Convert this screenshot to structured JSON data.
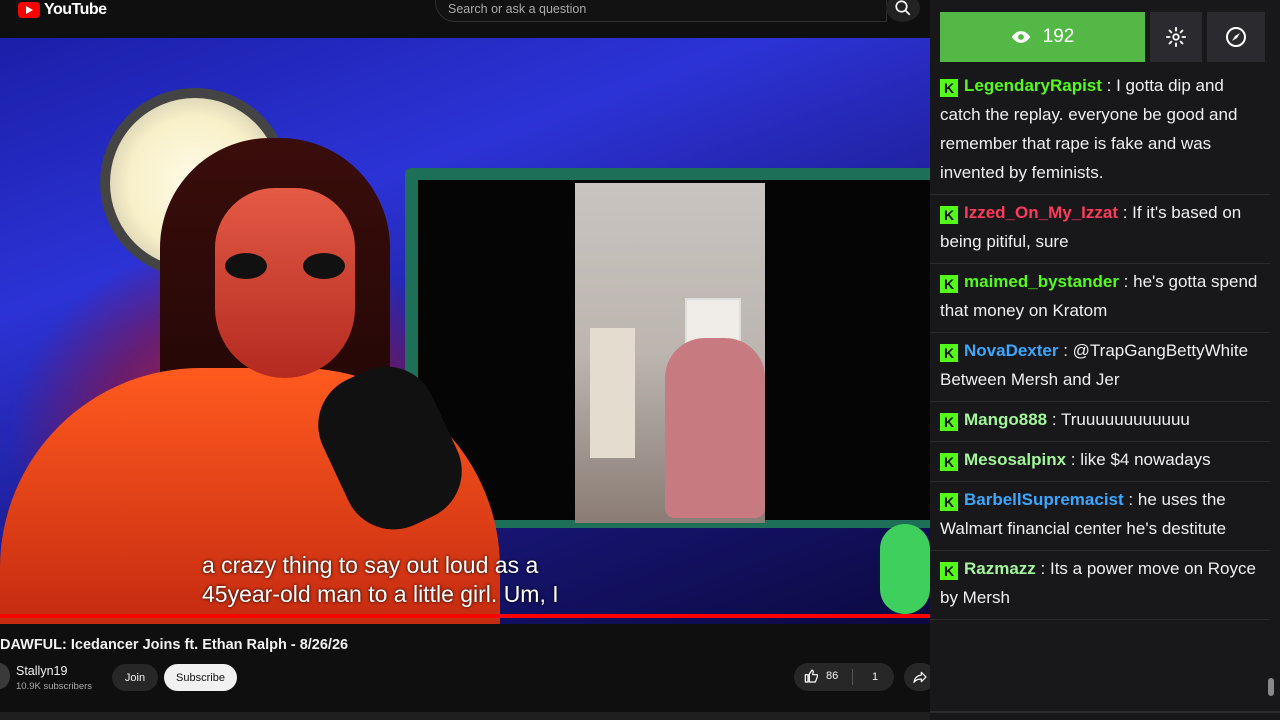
{
  "header": {
    "logo_text": "YouTube",
    "search_placeholder": "Search or ask a question"
  },
  "video": {
    "caption_line1": "a crazy thing to say out loud as a",
    "caption_line2": "45year-old man to a little girl. Um, I",
    "progress_fraction": 1.0,
    "title": "DAWFUL: Icedancer Joins ft. Ethan Ralph - 8/26/26"
  },
  "channel": {
    "name": "Stallyn19",
    "subscribers": "10.9K subscribers",
    "join_label": "Join",
    "subscribe_label": "Subscribe"
  },
  "actions": {
    "like_count": "86",
    "dislike_count": "1"
  },
  "chat": {
    "viewer_count": "192",
    "badge_letter": "K",
    "accent_color": "#53b846",
    "messages": [
      {
        "user": "LegendaryRapist",
        "color": "#53fc18",
        "text": "I gotta dip and catch the replay. everyone be good and remember that rape is fake and was invented by feminists."
      },
      {
        "user": "Izzed_On_My_Izzat",
        "color": "#ff3b5c",
        "text": "If it's based on being pitiful, sure"
      },
      {
        "user": "maimed_bystander",
        "color": "#53fc18",
        "text": "he's gotta spend that money on Kratom"
      },
      {
        "user": "NovaDexter",
        "color": "#3ba7ff",
        "text": "@TrapGangBettyWhite Between Mersh and Jer"
      },
      {
        "user": "Mango888",
        "color": "#a3f59a",
        "text": "Truuuuuuuuuuuu"
      },
      {
        "user": "Mesosalpinx",
        "color": "#a3f59a",
        "text": "like $4 nowadays"
      },
      {
        "user": "BarbellSupremacist",
        "color": "#3ba7ff",
        "text": "he uses the Walmart financial center he's destitute"
      },
      {
        "user": "Razmazz",
        "color": "#a3f59a",
        "text": "Its a power move on Royce by Mersh"
      }
    ]
  }
}
